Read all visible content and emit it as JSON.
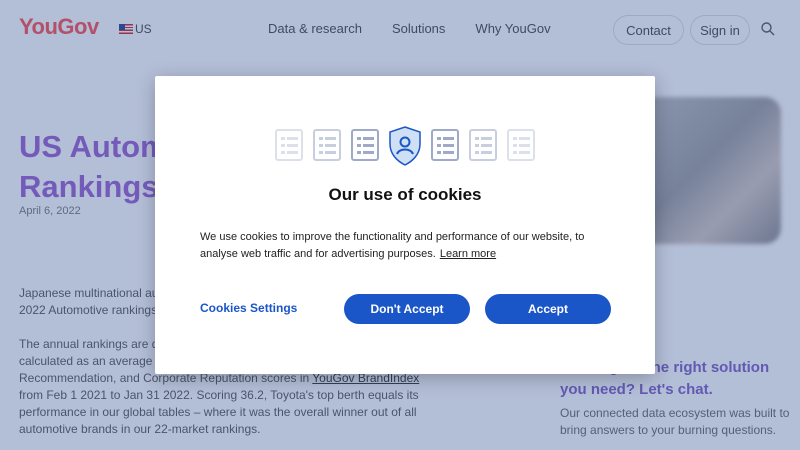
{
  "brand": {
    "logo": "YouGov",
    "region": "US"
  },
  "nav": {
    "links": [
      "Data & research",
      "Solutions",
      "Why YouGov"
    ],
    "contact": "Contact",
    "sign_in": "Sign in"
  },
  "article": {
    "title": "US Automotive Rankings 2022",
    "date": "April 6, 2022",
    "intro": "Japanese multinational automotive manufacturer Toyota has topped YouGov's 2022 Automotive rankings.",
    "body_before_link": "The annual rankings are determined by the Index score of overall brand health calculated as an average of Impression, Quality, Value, Customer Satisfaction, Recommendation, and Corporate Reputation scores in ",
    "body_link": "YouGov BrandIndex",
    "body_after_link": " from Feb 1 2021 to Jan 31 2022. Scoring 36.2, Toyota's top berth equals its performance in our global tables – where it was the overall winner out of all automotive brands in our 22-market rankings."
  },
  "cta": {
    "title": "Looking for the right solution you need? Let's chat.",
    "text": "Our connected data ecosystem was built to bring answers to your burning questions."
  },
  "cookie_modal": {
    "title": "Our use of cookies",
    "text": "We use cookies to improve the functionality and performance of our website, to analyse web traffic and for advertising purposes.",
    "learn_more": "Learn more",
    "settings": "Cookies Settings",
    "reject": "Don't Accept",
    "accept": "Accept"
  },
  "colors": {
    "accent": "#1a56c8",
    "brand": "#ff4f4f",
    "headline": "#9a5fd0"
  },
  "icons": [
    "flag-icon",
    "search-icon",
    "shield-user-icon",
    "list-card-icon"
  ]
}
